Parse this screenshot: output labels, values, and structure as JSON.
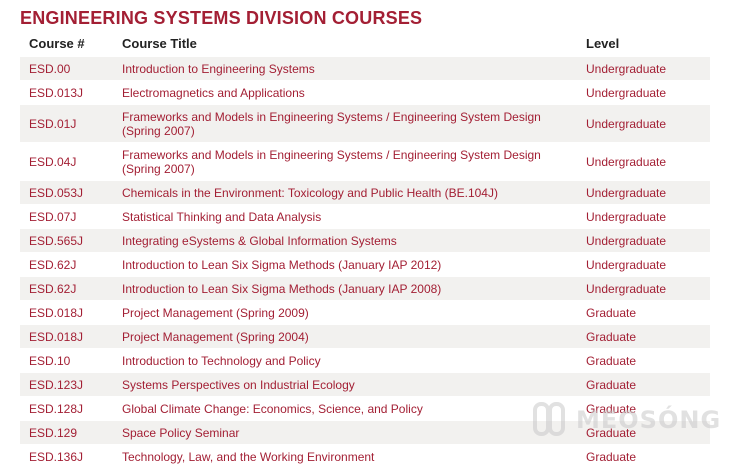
{
  "title": "ENGINEERING SYSTEMS DIVISION COURSES",
  "columns": {
    "num": "Course #",
    "title": "Course Title",
    "level": "Level"
  },
  "rows": [
    {
      "num": "ESD.00",
      "title": "Introduction to Engineering Systems",
      "level": "Undergraduate"
    },
    {
      "num": "ESD.013J",
      "title": "Electromagnetics and Applications",
      "level": "Undergraduate"
    },
    {
      "num": "ESD.01J",
      "title": "Frameworks and Models in Engineering Systems / Engineering System Design (Spring 2007)",
      "level": "Undergraduate"
    },
    {
      "num": "ESD.04J",
      "title": "Frameworks and Models in Engineering Systems / Engineering System Design (Spring 2007)",
      "level": "Undergraduate"
    },
    {
      "num": "ESD.053J",
      "title": "Chemicals in the Environment: Toxicology and Public Health (BE.104J)",
      "level": "Undergraduate"
    },
    {
      "num": "ESD.07J",
      "title": "Statistical Thinking and Data Analysis",
      "level": "Undergraduate"
    },
    {
      "num": "ESD.565J",
      "title": "Integrating eSystems & Global Information Systems",
      "level": "Undergraduate"
    },
    {
      "num": "ESD.62J",
      "title": "Introduction to Lean Six Sigma Methods (January IAP 2012)",
      "level": "Undergraduate"
    },
    {
      "num": "ESD.62J",
      "title": "Introduction to Lean Six Sigma Methods (January IAP 2008)",
      "level": "Undergraduate"
    },
    {
      "num": "ESD.018J",
      "title": "Project Management (Spring 2009)",
      "level": "Graduate"
    },
    {
      "num": "ESD.018J",
      "title": "Project Management (Spring 2004)",
      "level": "Graduate"
    },
    {
      "num": "ESD.10",
      "title": "Introduction to Technology and Policy",
      "level": "Graduate"
    },
    {
      "num": "ESD.123J",
      "title": "Systems Perspectives on Industrial Ecology",
      "level": "Graduate"
    },
    {
      "num": "ESD.128J",
      "title": "Global Climate Change: Economics, Science, and Policy",
      "level": "Graduate"
    },
    {
      "num": "ESD.129",
      "title": "Space Policy Seminar",
      "level": "Graduate"
    },
    {
      "num": "ESD.136J",
      "title": "Technology, Law, and the Working Environment",
      "level": "Graduate"
    }
  ],
  "watermark": {
    "text": "MEOSÓNG",
    "icon": "watermark-logo-icon"
  },
  "colors": {
    "accent": "#a31f34",
    "stripe": "#f2f1ef"
  }
}
